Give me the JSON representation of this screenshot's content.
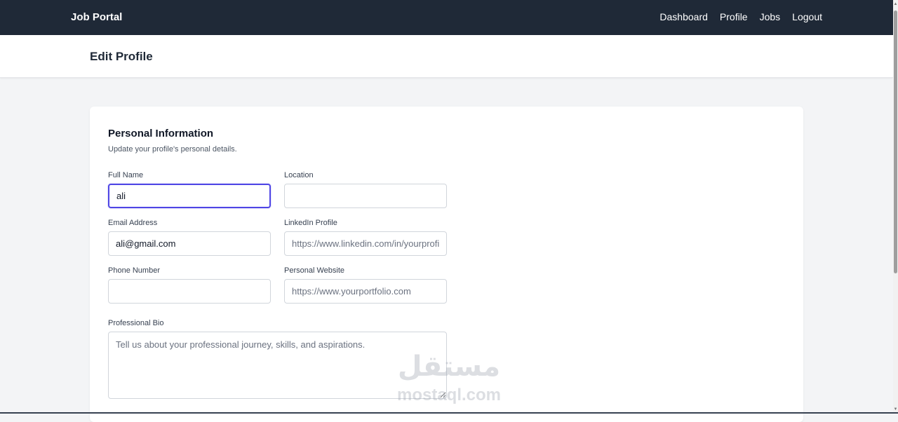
{
  "navbar": {
    "brand": "Job Portal",
    "links": [
      "Dashboard",
      "Profile",
      "Jobs",
      "Logout"
    ]
  },
  "header": {
    "title": "Edit Profile"
  },
  "personal_info": {
    "title": "Personal Information",
    "description": "Update your profile's personal details.",
    "fields": {
      "full_name": {
        "label": "Full Name",
        "value": "ali",
        "placeholder": ""
      },
      "location": {
        "label": "Location",
        "value": "",
        "placeholder": ""
      },
      "email": {
        "label": "Email Address",
        "value": "ali@gmail.com",
        "placeholder": ""
      },
      "linkedin": {
        "label": "LinkedIn Profile",
        "value": "",
        "placeholder": "https://www.linkedin.com/in/yourprofile"
      },
      "phone": {
        "label": "Phone Number",
        "value": "",
        "placeholder": ""
      },
      "website": {
        "label": "Personal Website",
        "value": "",
        "placeholder": "https://www.yourportfolio.com"
      },
      "bio": {
        "label": "Professional Bio",
        "value": "",
        "placeholder": "Tell us about your professional journey, skills, and aspirations."
      }
    }
  },
  "watermark": {
    "arabic": "مستقل",
    "latin": "mostaql.com"
  },
  "colors": {
    "navbar_bg": "#1f2937",
    "focus_ring": "#4f46e5",
    "page_bg": "#f3f4f6"
  }
}
